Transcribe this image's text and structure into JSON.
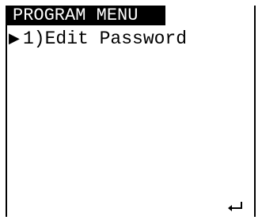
{
  "header": {
    "title": "PROGRAM MENU"
  },
  "menu": {
    "items": [
      {
        "selector": "▶",
        "label": "1)Edit Password"
      }
    ]
  },
  "footer": {
    "enter_icon": "enter-return-icon"
  }
}
